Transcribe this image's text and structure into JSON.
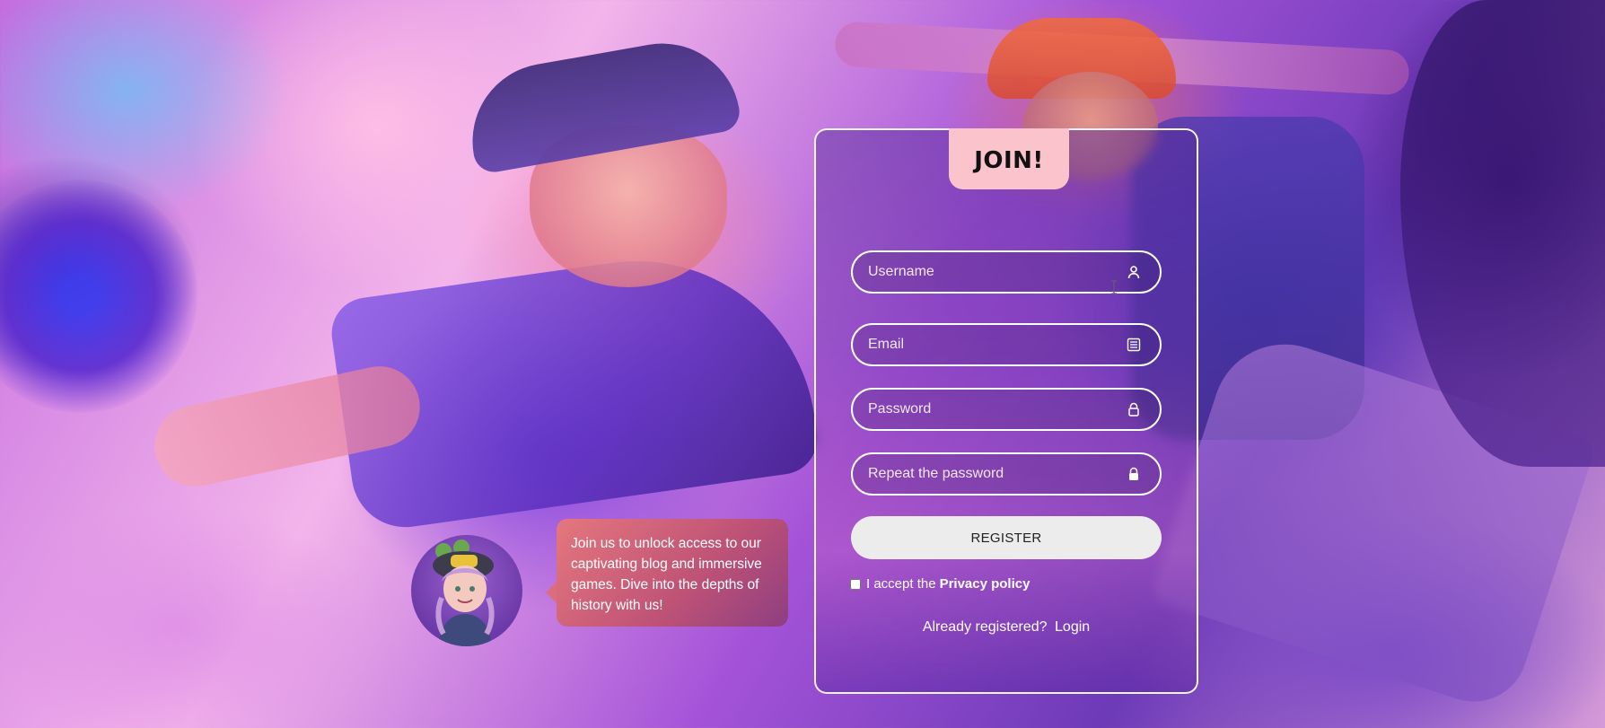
{
  "form": {
    "title": "JOIN!",
    "username_placeholder": "Username",
    "email_placeholder": "Email",
    "password_placeholder": "Password",
    "repeat_placeholder": "Repeat the password",
    "register_label": "REGISTER",
    "privacy_prefix": "I accept the",
    "privacy_link": "Privacy policy",
    "privacy_checked": false,
    "login_prefix": "Already registered?",
    "login_link": "Login"
  },
  "mascot": {
    "message": "Join us to unlock access to our captivating blog and immersive games. Dive into the depths of history with us!"
  },
  "icons": {
    "username": "user-icon",
    "email": "email-list-icon",
    "password": "lock-icon",
    "repeat": "lock-filled-icon"
  },
  "colors": {
    "tab_background": "#fbc4cc",
    "field_border": "#ffffff",
    "button_background": "#ececec",
    "speech_bubble": "#e07878"
  }
}
